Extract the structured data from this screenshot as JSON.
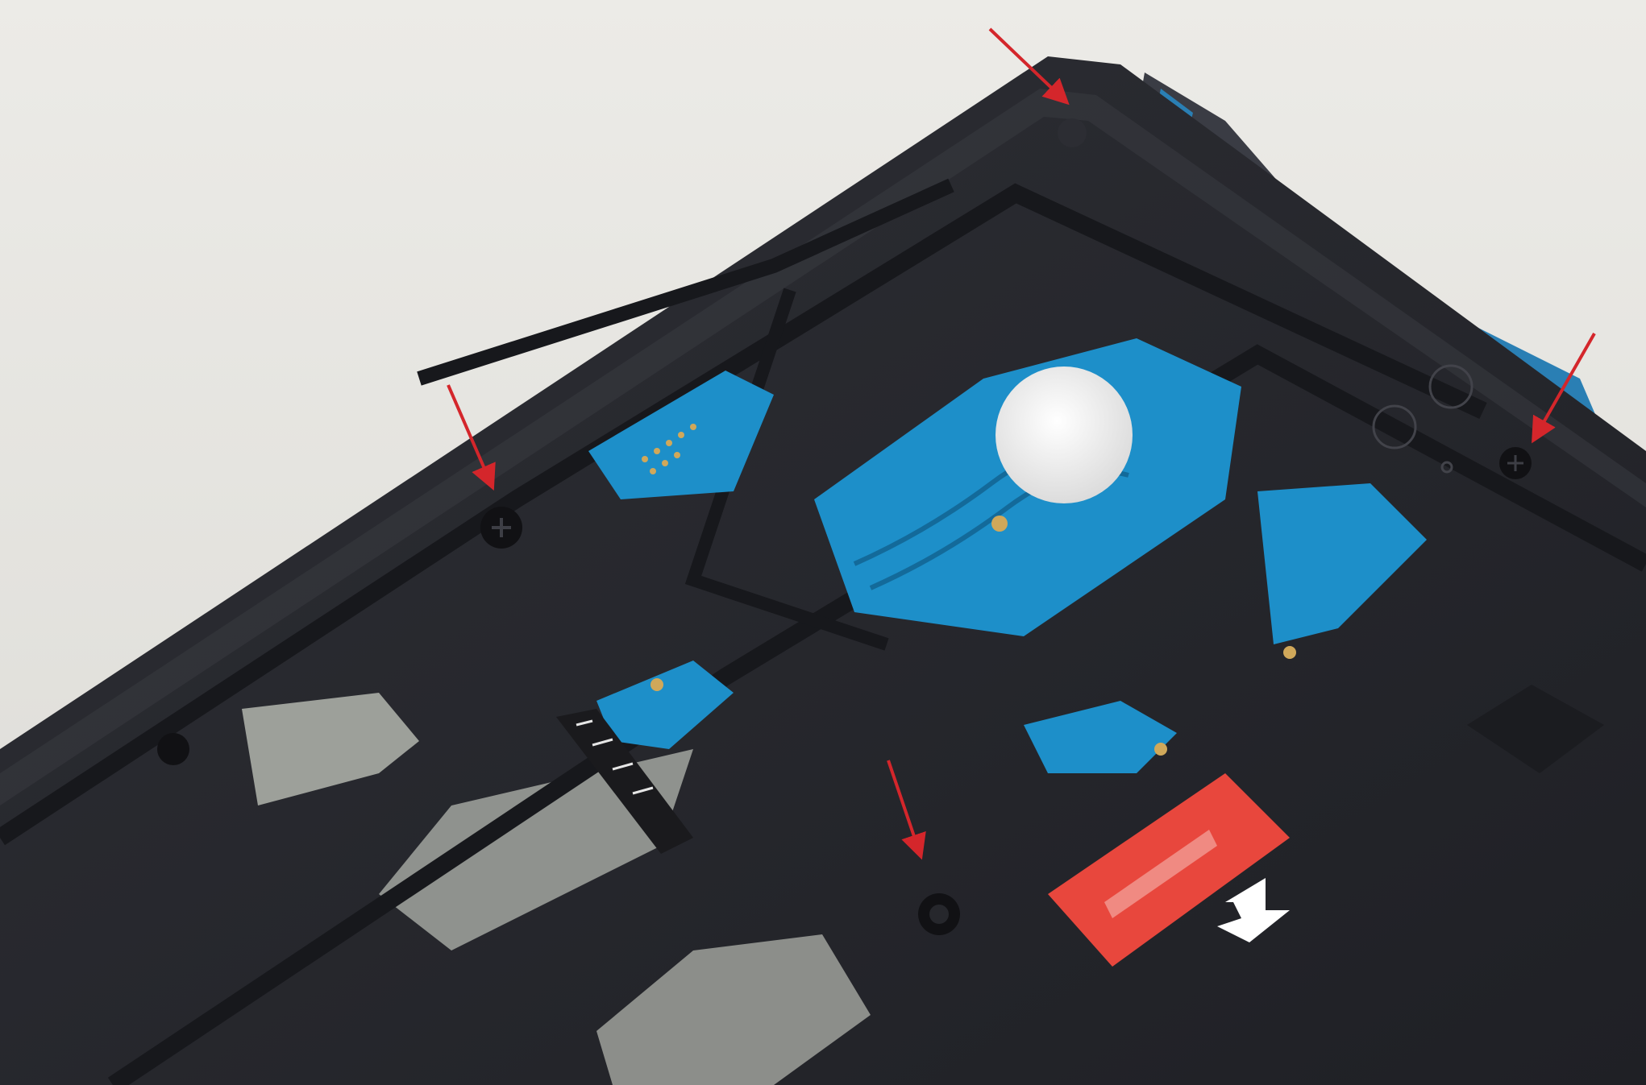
{
  "photo": {
    "subject": "",
    "colors": {
      "background": "#e7e6e2",
      "caddy": "#26272c",
      "caddy_edge": "#3a3b42",
      "pcb": "#1d8fc9",
      "pcb_dark": "#136a9a",
      "pad": "#d0a85a",
      "platter_label": "#f2f2f2",
      "sticker": "#e8473d",
      "arrow": "#d4262b",
      "screw": "#111114"
    }
  },
  "annotations": {
    "arrows": [
      {
        "points_to": "screw-top-right"
      },
      {
        "points_to": "screw-right"
      },
      {
        "points_to": "screw-left"
      },
      {
        "points_to": "screw-bottom"
      }
    ]
  }
}
